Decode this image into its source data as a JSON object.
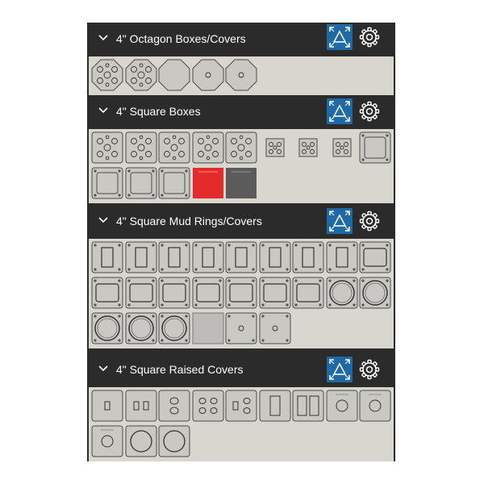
{
  "sections": [
    {
      "title": "4\" Octagon Boxes/Covers",
      "rows": [
        [
          "octagon-box-knockouts",
          "octagon-box-knockouts",
          "octagon-blank-cover",
          "octagon-cover-small-hole",
          "octagon-cover-small-hole"
        ]
      ]
    },
    {
      "title": "4\" Square Boxes",
      "rows": [
        [
          "square-box-knockouts",
          "square-box-knockouts",
          "square-box-knockouts",
          "square-box-knockouts",
          "square-box-knockouts",
          "square-box-small",
          "square-box-small",
          "square-box-small",
          "square-ring-frame"
        ],
        [
          "square-ring-frame",
          "square-ring-frame",
          "square-ring-frame",
          "red-tile",
          "dark-tile"
        ]
      ]
    },
    {
      "title": "4\" Square Mud Rings/Covers",
      "rows": [
        [
          "single-gang-ring",
          "single-gang-ring",
          "single-gang-ring",
          "single-gang-ring",
          "single-gang-ring",
          "single-gang-ring",
          "single-gang-ring",
          "single-gang-ring",
          "square-ring-wide"
        ],
        [
          "square-ring-wide",
          "square-ring-wide",
          "square-ring-wide",
          "square-ring-wide",
          "square-ring-wide",
          "square-ring-wide",
          "square-ring-wide",
          "round-ring",
          "round-ring"
        ],
        [
          "round-ring",
          "round-ring",
          "round-ring",
          "plain-gray-tile",
          "square-cover-small-hole",
          "square-cover-small-hole"
        ]
      ]
    },
    {
      "title": "4\" Square Raised Covers",
      "rows": [
        [
          "raised-toggle",
          "raised-double-toggle",
          "raised-duplex",
          "raised-double-duplex",
          "raised-toggle-duplex",
          "raised-decora",
          "raised-double-decora",
          "raised-round",
          "raised-round"
        ],
        [
          "raised-round",
          "raised-round-large",
          "raised-round-large"
        ]
      ]
    }
  ],
  "colors": {
    "header_bg": "#2b2b2b",
    "accent": "#1f6aa5",
    "grid_bg": "#d8d6cf",
    "tile_fill": "#c9c8c3",
    "red_tile": "#e32b2b",
    "dark_tile": "#5b5b5b"
  },
  "icons": {
    "collapse": "chevron-down-icon",
    "expand": "expand-arrows-icon",
    "settings": "gear-icon"
  }
}
